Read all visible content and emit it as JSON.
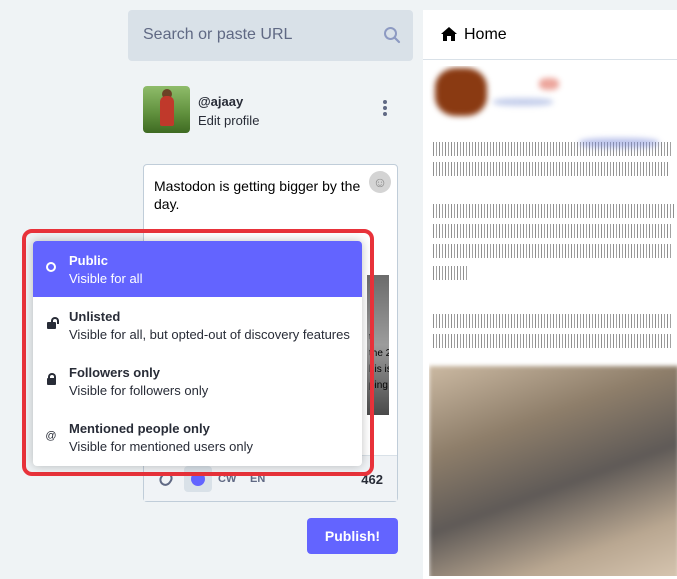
{
  "search": {
    "placeholder": "Search or paste URL",
    "icon": "search-icon"
  },
  "profile": {
    "username": "@ajaay",
    "edit_label": "Edit profile",
    "menu_icon": "kebab-icon"
  },
  "compose": {
    "text": "Mastodon is getting bigger by the day.",
    "emoji_icon": "emoji-icon",
    "preview_snippet": [
      "t",
      "the 2",
      "his is",
      "ping th"
    ],
    "toolbar": {
      "attach_icon": "paperclip-icon",
      "privacy_icon": "globe-icon",
      "cw_label": "CW",
      "language_label": "EN",
      "char_count": "462"
    },
    "publish_label": "Publish!"
  },
  "privacy_menu": {
    "options": [
      {
        "icon": "globe-icon",
        "title": "Public",
        "description": "Visible for all",
        "selected": true
      },
      {
        "icon": "unlock-icon",
        "title": "Unlisted",
        "description": "Visible for all, but opted-out of discovery features",
        "selected": false
      },
      {
        "icon": "lock-icon",
        "title": "Followers only",
        "description": "Visible for followers only",
        "selected": false
      },
      {
        "icon": "at-icon",
        "title": "Mentioned people only",
        "description": "Visible for mentioned users only",
        "selected": false
      }
    ]
  },
  "home": {
    "title": "Home",
    "icon": "home-icon"
  },
  "colors": {
    "accent": "#6364ff",
    "highlight": "#e8323a",
    "background": "#eff3f5"
  }
}
